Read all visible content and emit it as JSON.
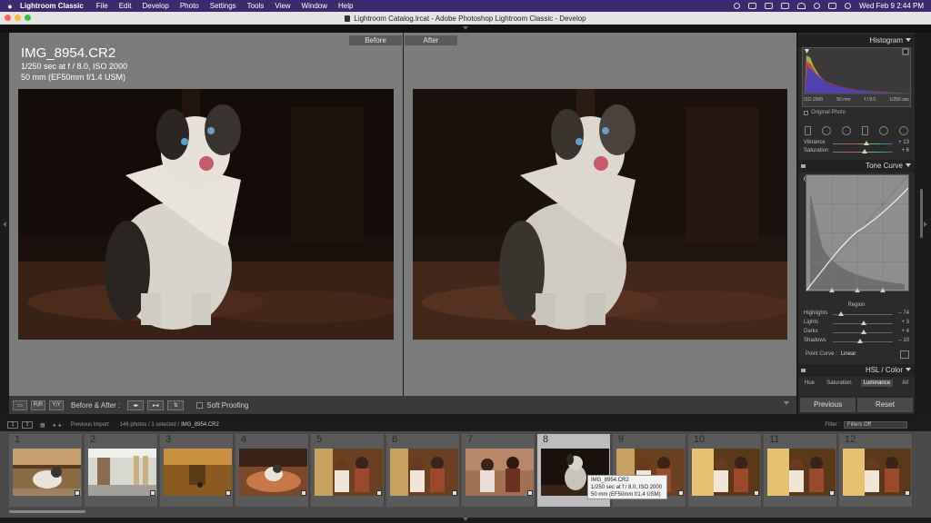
{
  "menubar": {
    "app": "Lightroom Classic",
    "items": [
      "File",
      "Edit",
      "Develop",
      "Photo",
      "Settings",
      "Tools",
      "View",
      "Window",
      "Help"
    ],
    "clock": "Wed Feb 9  2:44 PM"
  },
  "window": {
    "title": "Lightroom Catalog.lrcat - Adobe Photoshop Lightroom Classic - Develop"
  },
  "viewer": {
    "before_label": "Before",
    "after_label": "After",
    "filename": "IMG_8954.CR2",
    "exposure": "1/250 sec at f / 8.0, ISO 2000",
    "lens": "50 mm (EF50mm f/1.4 USM)"
  },
  "toolbar": {
    "view_mode_1": "▭",
    "view_mode_2": "R|R",
    "view_mode_3": "Y|Y",
    "before_after_label": "Before & After :",
    "btn1": "◂▸",
    "btn2": "▸◂",
    "btn3": "⇅",
    "soft_proofing": "Soft Proofing"
  },
  "histogram": {
    "title": "Histogram",
    "iso": "ISO 2000",
    "focal": "50 mm",
    "aperture": "f / 8.0",
    "shutter": "1/250 sec",
    "original_photo": "Original Photo"
  },
  "basic_partial": {
    "vibrance_label": "Vibrance",
    "vibrance_value": "+ 13",
    "vibrance_level": 0.56,
    "saturation_label": "Saturation",
    "saturation_value": "+ 6",
    "saturation_level": 0.53
  },
  "tone_curve": {
    "title": "Tone Curve",
    "region_label": "Region",
    "sliders": [
      {
        "label": "Highlights",
        "value": "– 74",
        "level": 0.13
      },
      {
        "label": "Lights",
        "value": "+ 3",
        "level": 0.52
      },
      {
        "label": "Darks",
        "value": "+ 4",
        "level": 0.52
      },
      {
        "label": "Shadows",
        "value": "– 10",
        "level": 0.45
      }
    ],
    "point_curve_label": "Point Curve :",
    "point_curve_value": "Linear"
  },
  "hsl": {
    "title": "HSL / Color",
    "tabs": [
      "Hue",
      "Saturation",
      "Luminance",
      "All"
    ],
    "active_tab": "Luminance"
  },
  "buttons": {
    "previous": "Previous",
    "reset": "Reset"
  },
  "filmstrip_bar": {
    "page1": "1",
    "page2": "2",
    "source": "Previous Import",
    "summary": "146 photos / 1 selected /",
    "current_file": "IMG_8954.CR2",
    "filter_label": "Filter :",
    "filter_value": "Filters Off"
  },
  "filmstrip": {
    "cells": [
      {
        "num": "1",
        "kind": "dog-outdoor"
      },
      {
        "num": "2",
        "kind": "kitchen"
      },
      {
        "num": "3",
        "kind": "warm-room"
      },
      {
        "num": "4",
        "kind": "dog-bed"
      },
      {
        "num": "5",
        "kind": "couple"
      },
      {
        "num": "6",
        "kind": "couple"
      },
      {
        "num": "7",
        "kind": "couple-bright"
      },
      {
        "num": "8",
        "kind": "dog-dark"
      },
      {
        "num": "9",
        "kind": "couple"
      },
      {
        "num": "10",
        "kind": "couple-window"
      },
      {
        "num": "11",
        "kind": "couple-window"
      },
      {
        "num": "12",
        "kind": "couple-window"
      }
    ],
    "selected_index": 7
  },
  "tooltip": {
    "line1": "IMG_8954.CR2",
    "line2": "1/250 sec at f / 8.0, ISO 2000",
    "line3": "50 mm (EF50mm f/1.4 USM)"
  },
  "colors": {
    "menubar": "#3c2a6e",
    "viewer_bg": "#7b7b7b",
    "panel_bg": "#2b2b2b"
  }
}
